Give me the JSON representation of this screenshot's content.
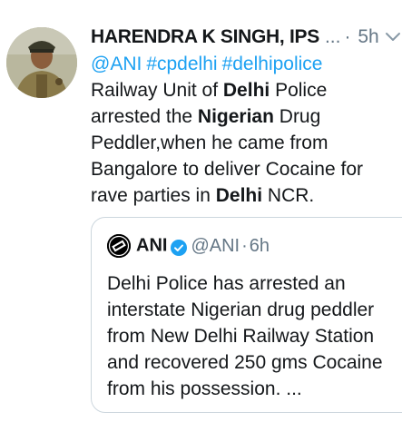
{
  "tweet": {
    "author_name": "HARENDRA K SINGH, IPS",
    "truncation": "...",
    "separator": "·",
    "time": "5h",
    "hashtags": [
      "@ANI",
      "#cpdelhi",
      "#delhipolice"
    ],
    "body": {
      "p1": "Railway Unit of ",
      "b1": "Delhi",
      "p2": " Police arrested the ",
      "b2": "Nigerian",
      "p3": " Drug Peddler,when he came from Bangalore to deliver Cocaine for rave parties in ",
      "b3": "Delhi",
      "p4": " NCR."
    },
    "icons": {
      "menu": "chevron-down-icon",
      "avatar": "profile-photo"
    }
  },
  "quoted_tweet": {
    "author_name": "ANI",
    "handle": "@ANI",
    "separator": "·",
    "time": "6h",
    "text": "Delhi Police has arrested an interstate Nigerian drug peddler from New Delhi Railway Station and recovered 250 gms Cocaine from his possession. ...",
    "icons": {
      "avatar": "ani-logo-icon",
      "verified": "verified-badge-icon"
    }
  },
  "colors": {
    "link": "#1da1f2",
    "text": "#14171a",
    "muted": "#657786",
    "border": "#ccd6dd",
    "verified": "#1da1f2"
  }
}
